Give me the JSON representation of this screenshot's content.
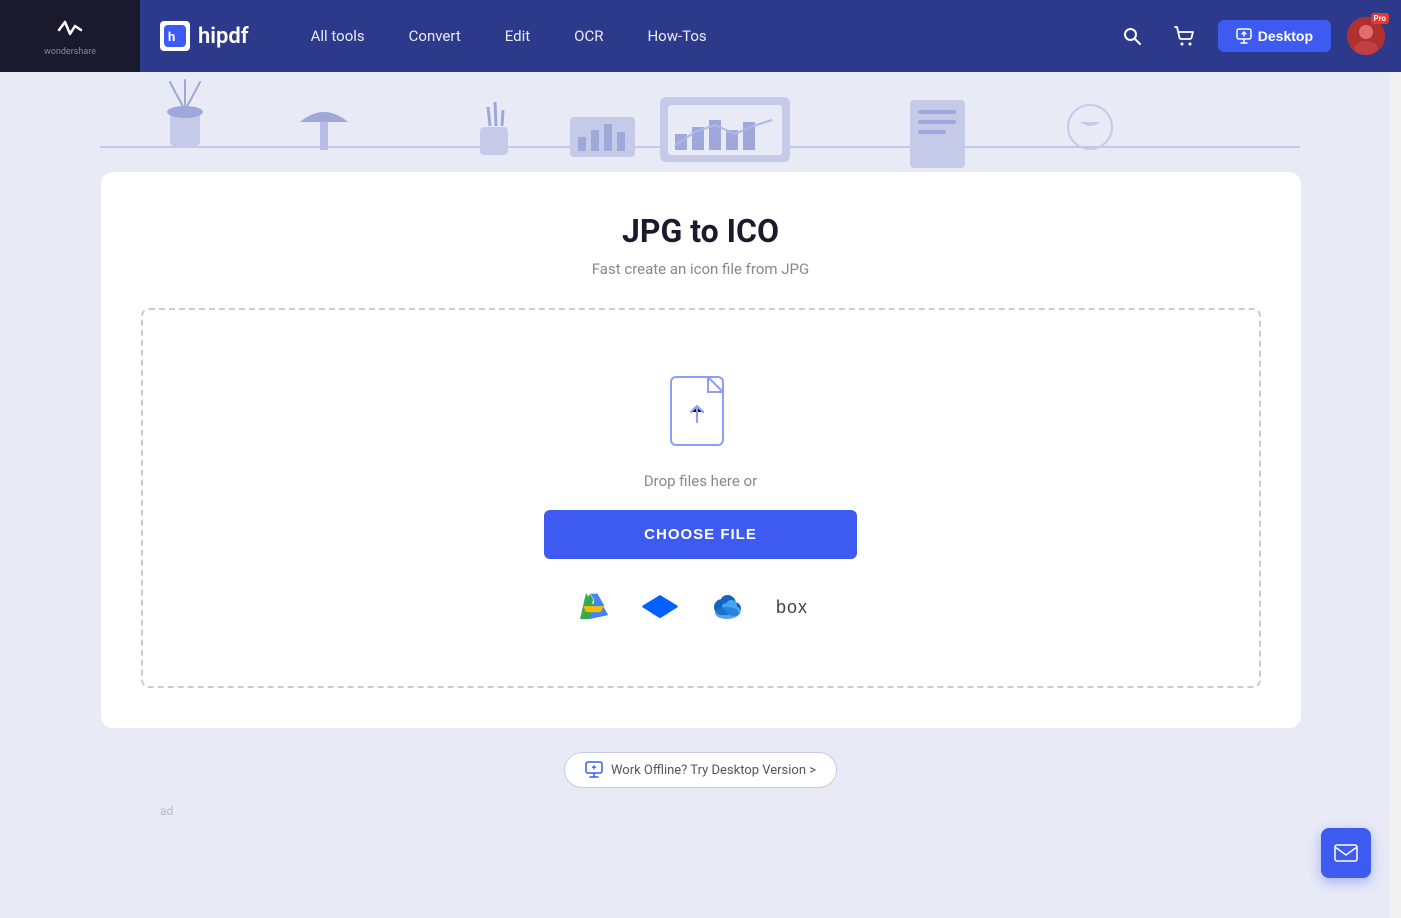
{
  "brand": {
    "wondershare": "wondershare",
    "hipdf": "hipdf"
  },
  "navbar": {
    "logo_letter": "h",
    "links": [
      {
        "label": "All tools",
        "id": "all-tools"
      },
      {
        "label": "Convert",
        "id": "convert"
      },
      {
        "label": "Edit",
        "id": "edit"
      },
      {
        "label": "OCR",
        "id": "ocr"
      },
      {
        "label": "How-Tos",
        "id": "how-tos"
      }
    ],
    "desktop_btn": "Desktop",
    "desktop_icon": "⬆"
  },
  "page": {
    "title": "JPG to ICO",
    "subtitle": "Fast create an icon file from JPG",
    "drop_text": "Drop files here or",
    "choose_btn": "CHOOSE FILE",
    "offline_text": "Work Offline? Try Desktop Version >"
  },
  "cloud_services": [
    {
      "name": "Google Drive",
      "id": "gdrive"
    },
    {
      "name": "Dropbox",
      "id": "dropbox"
    },
    {
      "name": "OneDrive",
      "id": "onedrive"
    },
    {
      "name": "Box",
      "id": "box"
    }
  ],
  "footer": {
    "ad": "ad"
  }
}
